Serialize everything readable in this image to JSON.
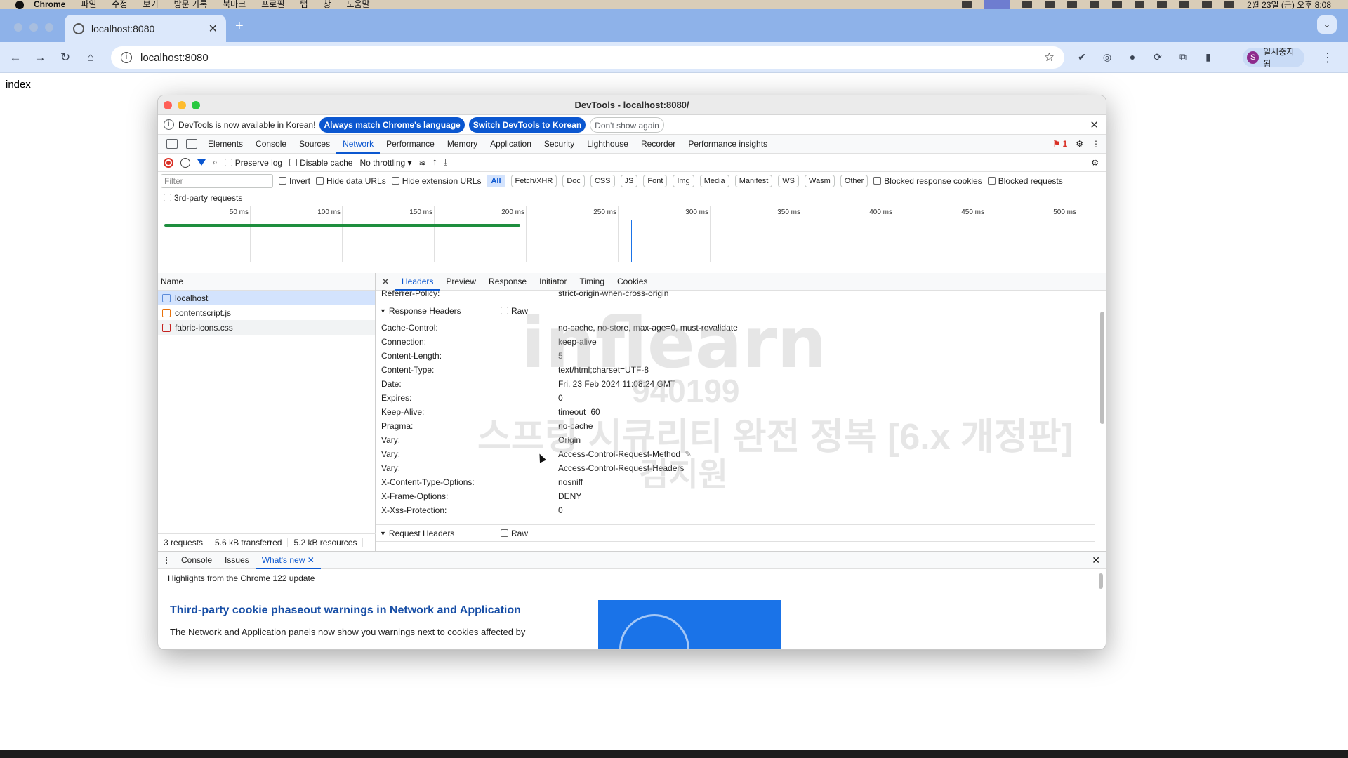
{
  "menubar": {
    "app_name": "Chrome",
    "items": [
      "파일",
      "수정",
      "보기",
      "방문 기록",
      "북마크",
      "프로필",
      "탭",
      "창",
      "도움말"
    ],
    "clock": "2월 23일 (금) 오후 8:08"
  },
  "browser": {
    "tab_title": "localhost:8080",
    "url": "localhost:8080",
    "profile_label": "일시중지됨",
    "profile_initial": "S",
    "page_text": "index"
  },
  "devtools": {
    "window_title": "DevTools - localhost:8080/",
    "infobar": {
      "message": "DevTools is now available in Korean!",
      "btn_match": "Always match Chrome's language",
      "btn_switch": "Switch DevTools to Korean",
      "btn_dismiss": "Don't show again"
    },
    "panels": [
      "Elements",
      "Console",
      "Sources",
      "Network",
      "Performance",
      "Memory",
      "Application",
      "Security",
      "Lighthouse",
      "Recorder",
      "Performance insights"
    ],
    "active_panel": "Network",
    "issues_count": "1",
    "network_toolbar": {
      "preserve_log": "Preserve log",
      "disable_cache": "Disable cache",
      "throttling": "No throttling"
    },
    "filter": {
      "placeholder": "Filter",
      "invert": "Invert",
      "hide_data_urls": "Hide data URLs",
      "hide_extension_urls": "Hide extension URLs",
      "types": [
        "All",
        "Fetch/XHR",
        "Doc",
        "CSS",
        "JS",
        "Font",
        "Img",
        "Media",
        "Manifest",
        "WS",
        "Wasm",
        "Other"
      ],
      "blocked_cookies": "Blocked response cookies",
      "blocked_requests": "Blocked requests",
      "third_party": "3rd-party requests"
    },
    "timeline_ticks": [
      "50 ms",
      "100 ms",
      "150 ms",
      "200 ms",
      "250 ms",
      "300 ms",
      "350 ms",
      "400 ms",
      "450 ms",
      "500 ms"
    ],
    "requests_header": "Name",
    "requests": [
      "localhost",
      "contentscript.js",
      "fabric-icons.css"
    ],
    "footer": {
      "requests": "3 requests",
      "transferred": "5.6 kB transferred",
      "resources": "5.2 kB resources"
    },
    "detail_tabs": [
      "Headers",
      "Preview",
      "Response",
      "Initiator",
      "Timing",
      "Cookies"
    ],
    "referrer": {
      "key": "Referrer-Policy:",
      "value": "strict-origin-when-cross-origin"
    },
    "response_section": "Response Headers",
    "request_section": "Request Headers",
    "raw_label": "Raw",
    "response_headers": [
      {
        "k": "Cache-Control:",
        "v": "no-cache, no-store, max-age=0, must-revalidate"
      },
      {
        "k": "Connection:",
        "v": "keep-alive"
      },
      {
        "k": "Content-Length:",
        "v": "5"
      },
      {
        "k": "Content-Type:",
        "v": "text/html;charset=UTF-8"
      },
      {
        "k": "Date:",
        "v": "Fri, 23 Feb 2024 11:08:24 GMT"
      },
      {
        "k": "Expires:",
        "v": "0"
      },
      {
        "k": "Keep-Alive:",
        "v": "timeout=60"
      },
      {
        "k": "Pragma:",
        "v": "no-cache"
      },
      {
        "k": "Vary:",
        "v": "Origin"
      },
      {
        "k": "Vary:",
        "v": "Access-Control-Request-Method"
      },
      {
        "k": "Vary:",
        "v": "Access-Control-Request-Headers"
      },
      {
        "k": "X-Content-Type-Options:",
        "v": "nosniff"
      },
      {
        "k": "X-Frame-Options:",
        "v": "DENY"
      },
      {
        "k": "X-Xss-Protection:",
        "v": "0"
      }
    ],
    "drawer": {
      "tabs": [
        "Console",
        "Issues",
        "What's new"
      ],
      "active": "What's new",
      "highlights": "Highlights from the Chrome 122 update",
      "title": "Third-party cookie phaseout warnings in Network and Application",
      "body": "The Network and Application panels now show you warnings next to cookies affected by"
    }
  },
  "watermark": {
    "line1": "inflearn",
    "line2": "940199",
    "line3": "스프링 시큐리티 완전 정복 [6.x 개정판]",
    "line4": "김지원"
  },
  "colors": {
    "accent": "#0b57d0",
    "tabstrip": "#8eb2e9",
    "record": "#d93025",
    "green": "#1e8e3e"
  }
}
